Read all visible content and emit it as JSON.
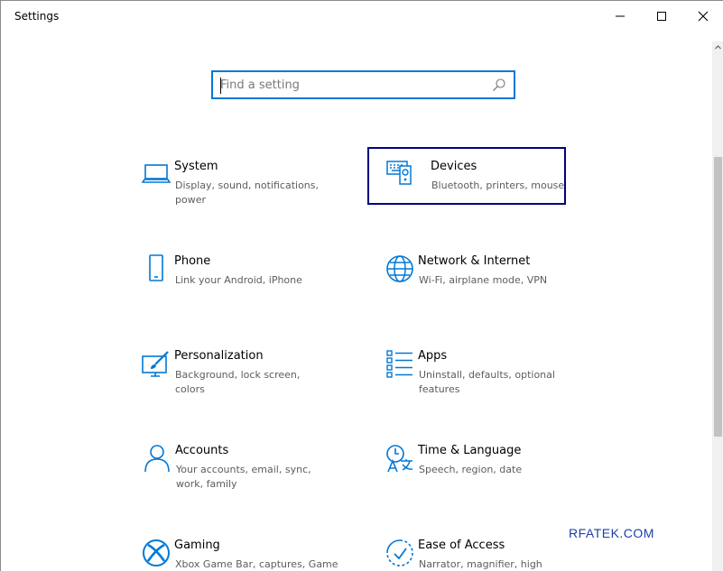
{
  "window": {
    "title": "Settings",
    "controls": [
      "minimize-icon",
      "maximize-icon",
      "close-icon"
    ]
  },
  "search": {
    "placeholder": "Find a setting",
    "icon": "search-icon"
  },
  "tiles": [
    {
      "name": "System",
      "desc": "Display, sound, notifications, power",
      "icon": "laptop-icon"
    },
    {
      "name": "Devices",
      "desc": "Bluetooth, printers, mouse",
      "icon": "keyboard-speaker-icon",
      "focused": true
    },
    {
      "name": "Phone",
      "desc": "Link your Android, iPhone",
      "icon": "phone-icon"
    },
    {
      "name": "Network & Internet",
      "desc": "Wi-Fi, airplane mode, VPN",
      "icon": "globe-icon"
    },
    {
      "name": "Personalization",
      "desc": "Background, lock screen, colors",
      "icon": "paintbrush-icon"
    },
    {
      "name": "Apps",
      "desc": "Uninstall, defaults, optional features",
      "icon": "apps-list-icon"
    },
    {
      "name": "Accounts",
      "desc": "Your accounts, email, sync, work, family",
      "icon": "person-icon"
    },
    {
      "name": "Time & Language",
      "desc": "Speech, region, date",
      "icon": "time-language-icon"
    },
    {
      "name": "Gaming",
      "desc": "Xbox Game Bar, captures, Game",
      "icon": "xbox-icon"
    },
    {
      "name": "Ease of Access",
      "desc": "Narrator, magnifier, high",
      "icon": "ease-of-access-icon"
    }
  ],
  "watermark": "RFATEK.COM",
  "colors": {
    "accent": "#0078d7",
    "focus": "#000080",
    "desc": "#5d5d5d"
  }
}
